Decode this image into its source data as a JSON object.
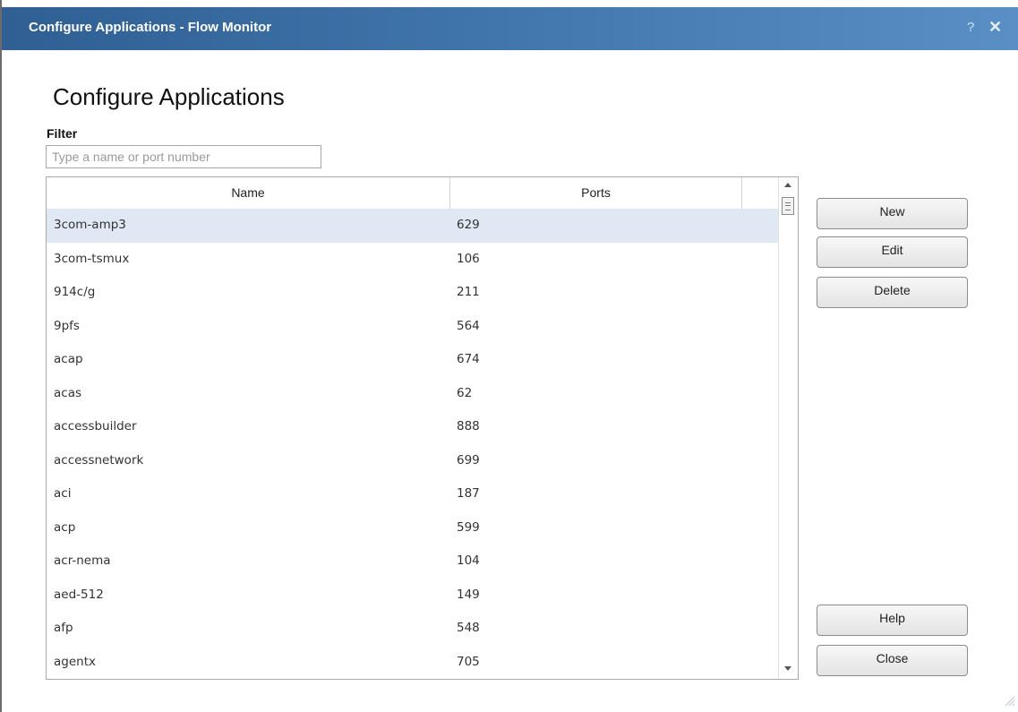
{
  "window": {
    "title": "Configure Applications - Flow Monitor",
    "help_glyph": "?",
    "close_glyph": "✕"
  },
  "heading": "Configure Applications",
  "filter": {
    "label": "Filter",
    "placeholder": "Type a name or port number",
    "value": ""
  },
  "table": {
    "columns": [
      "Name",
      "Ports"
    ],
    "rows": [
      {
        "name": "3com-amp3",
        "ports": "629"
      },
      {
        "name": "3com-tsmux",
        "ports": "106"
      },
      {
        "name": "914c/g",
        "ports": "211"
      },
      {
        "name": "9pfs",
        "ports": "564"
      },
      {
        "name": "acap",
        "ports": "674"
      },
      {
        "name": "acas",
        "ports": "62"
      },
      {
        "name": "accessbuilder",
        "ports": "888"
      },
      {
        "name": "accessnetwork",
        "ports": "699"
      },
      {
        "name": "aci",
        "ports": "187"
      },
      {
        "name": "acp",
        "ports": "599"
      },
      {
        "name": "acr-nema",
        "ports": "104"
      },
      {
        "name": "aed-512",
        "ports": "149"
      },
      {
        "name": "afp",
        "ports": "548"
      },
      {
        "name": "agentx",
        "ports": "705"
      }
    ],
    "selected_row": 0
  },
  "buttons": {
    "new": "New",
    "edit": "Edit",
    "delete": "Delete",
    "help": "Help",
    "close": "Close"
  },
  "colors": {
    "titlebar_start": "#2f5f93",
    "titlebar_end": "#5a8fc6",
    "selected_row": "#dfe8f3"
  }
}
